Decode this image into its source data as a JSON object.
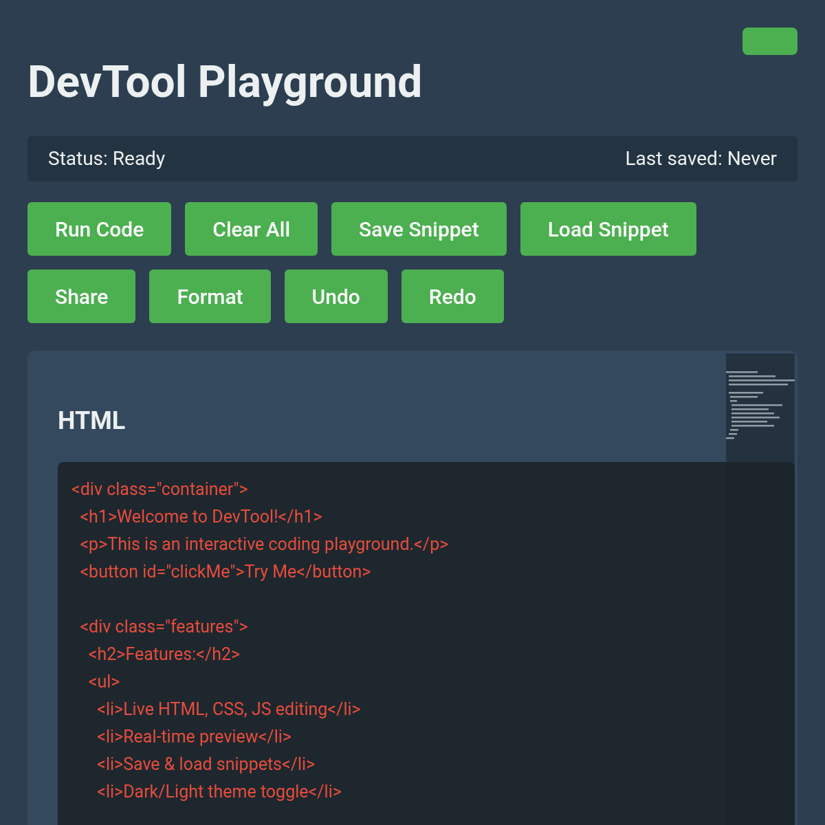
{
  "header": {
    "title": "DevTool Playground"
  },
  "status_bar": {
    "status": "Status: Ready",
    "last_saved": "Last saved: Never"
  },
  "toolbar": [
    [
      "Run Code",
      "Clear All",
      "Save Snippet",
      "Load Snippet"
    ],
    [
      "Share",
      "Format",
      "Undo",
      "Redo"
    ]
  ],
  "editor": {
    "title": "HTML",
    "code_blocks": [
      [
        "<div class=\"container\">",
        "  <h1>Welcome to DevTool!</h1>",
        "  <p>This is an interactive coding playground.</p>",
        "  <button id=\"clickMe\">Try Me</button>"
      ],
      [
        "  <div class=\"features\">",
        "    <h2>Features:</h2>",
        "    <ul>",
        "      <li>Live HTML, CSS, JS editing</li>",
        "      <li>Real-time preview</li>",
        "      <li>Save & load snippets</li>",
        "      <li>Dark/Light theme toggle</li>"
      ]
    ]
  }
}
